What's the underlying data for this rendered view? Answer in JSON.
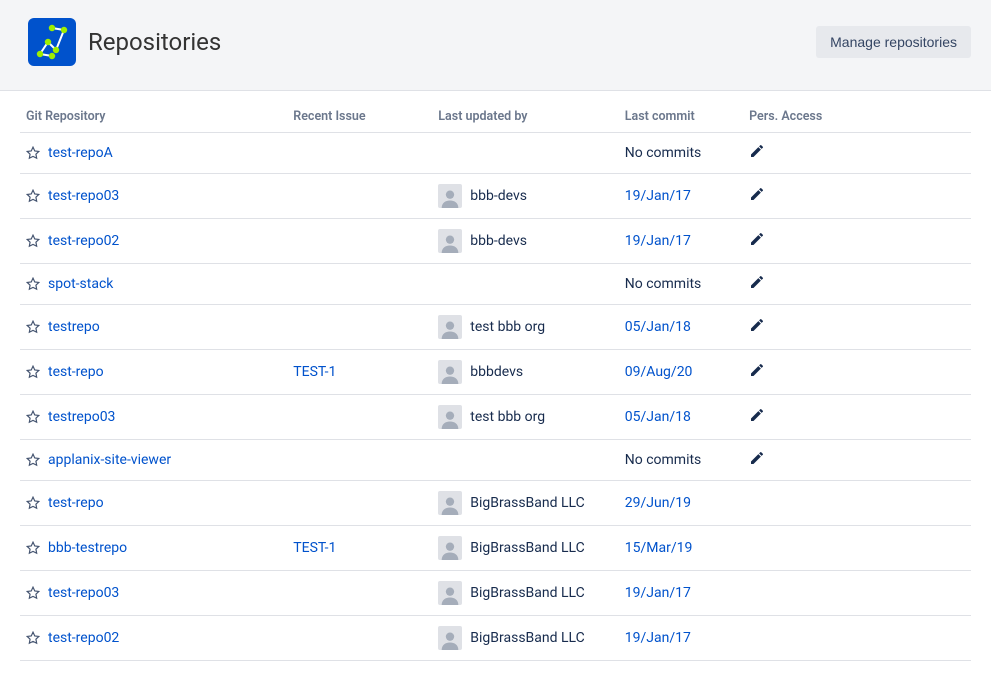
{
  "header": {
    "title": "Repositories",
    "manage_button": "Manage repositories"
  },
  "columns": {
    "repo": "Git Repository",
    "issue": "Recent Issue",
    "updated_by": "Last updated by",
    "last_commit": "Last commit",
    "access": "Pers. Access"
  },
  "no_commits_label": "No commits",
  "rows": [
    {
      "repo": "test-repoA",
      "issue": "",
      "updated_by": "",
      "last_commit": "",
      "has_edit": true
    },
    {
      "repo": "test-repo03",
      "issue": "",
      "updated_by": "bbb-devs",
      "last_commit": "19/Jan/17",
      "has_edit": true
    },
    {
      "repo": "test-repo02",
      "issue": "",
      "updated_by": "bbb-devs",
      "last_commit": "19/Jan/17",
      "has_edit": true
    },
    {
      "repo": "spot-stack",
      "issue": "",
      "updated_by": "",
      "last_commit": "",
      "has_edit": true
    },
    {
      "repo": "testrepo",
      "issue": "",
      "updated_by": "test bbb org",
      "last_commit": "05/Jan/18",
      "has_edit": true
    },
    {
      "repo": "test-repo",
      "issue": "TEST-1",
      "updated_by": "bbbdevs",
      "last_commit": "09/Aug/20",
      "has_edit": true
    },
    {
      "repo": "testrepo03",
      "issue": "",
      "updated_by": "test bbb org",
      "last_commit": "05/Jan/18",
      "has_edit": true
    },
    {
      "repo": "applanix-site-viewer",
      "issue": "",
      "updated_by": "",
      "last_commit": "",
      "has_edit": true
    },
    {
      "repo": "test-repo",
      "issue": "",
      "updated_by": "BigBrassBand LLC",
      "last_commit": "29/Jun/19",
      "has_edit": false
    },
    {
      "repo": "bbb-testrepo",
      "issue": "TEST-1",
      "updated_by": "BigBrassBand LLC",
      "last_commit": "15/Mar/19",
      "has_edit": false
    },
    {
      "repo": "test-repo03",
      "issue": "",
      "updated_by": "BigBrassBand LLC",
      "last_commit": "19/Jan/17",
      "has_edit": false
    },
    {
      "repo": "test-repo02",
      "issue": "",
      "updated_by": "BigBrassBand LLC",
      "last_commit": "19/Jan/17",
      "has_edit": false
    }
  ]
}
